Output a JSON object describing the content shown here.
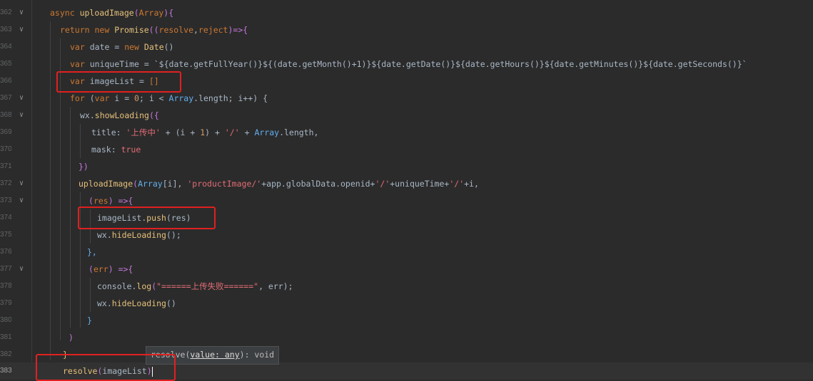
{
  "editor": {
    "lines": [
      {
        "num": "362",
        "fold": true
      },
      {
        "num": "363",
        "fold": true
      },
      {
        "num": "364",
        "fold": false
      },
      {
        "num": "365",
        "fold": false
      },
      {
        "num": "366",
        "fold": false
      },
      {
        "num": "367",
        "fold": true
      },
      {
        "num": "368",
        "fold": true
      },
      {
        "num": "369",
        "fold": false
      },
      {
        "num": "370",
        "fold": false
      },
      {
        "num": "371",
        "fold": false
      },
      {
        "num": "372",
        "fold": true
      },
      {
        "num": "373",
        "fold": true
      },
      {
        "num": "374",
        "fold": false
      },
      {
        "num": "375",
        "fold": false
      },
      {
        "num": "376",
        "fold": false
      },
      {
        "num": "377",
        "fold": true
      },
      {
        "num": "378",
        "fold": false
      },
      {
        "num": "379",
        "fold": false
      },
      {
        "num": "380",
        "fold": false
      },
      {
        "num": "381",
        "fold": false
      },
      {
        "num": "382",
        "fold": false
      },
      {
        "num": "383",
        "fold": false
      }
    ],
    "current_line": "383",
    "code": {
      "l362": {
        "kw": "async",
        "fn": "uploadImage",
        "open": "(",
        "param": "Array",
        "close": "){"
      },
      "l363": {
        "kw": "return",
        "kw2": "new",
        "cls": "Promise",
        "p1": "((",
        "a": "resolve",
        "comma": ",",
        "b": "reject",
        "p2": ")=>{"
      },
      "l364": {
        "kw": "var",
        "name": "date",
        "eq": " = ",
        "kw2": "new",
        "cls": "Date",
        "p": "()"
      },
      "l365": {
        "kw": "var",
        "name": "uniqueTime",
        "eq": " = ",
        "tpl": "`${date.getFullYear()}${(date.getMonth()+1)}${date.getDate()}${date.getHours()}${date.getMinutes()}${date.getSeconds()}`"
      },
      "l366": {
        "kw": "var",
        "name": "imageList",
        "eq": " = ",
        "val": "[]"
      },
      "l367": {
        "kw": "for",
        "open": " (",
        "kw2": "var",
        "rest1": " i = ",
        "zero": "0",
        "rest2": "; i < ",
        "arr": "Array",
        "rest3": ".length; i++) {"
      },
      "l368": {
        "obj": "wx",
        "dot": ".",
        "fn": "showLoading",
        "p": "({"
      },
      "l369": {
        "key": "title",
        "colon": ": ",
        "str": "'上传中'",
        "rest": " + (i + ",
        "one": "1",
        "rest2": ") + ",
        "str2": "'/'",
        "rest3": " + ",
        "arr": "Array",
        "rest4": ".length,"
      },
      "l370": {
        "key": "mask",
        "colon": ": ",
        "val": "true"
      },
      "l371": {
        "text": "})"
      },
      "l372": {
        "fn": "uploadImage",
        "open": "(",
        "arr": "Array",
        "rest1": "[i], ",
        "str": "'productImage/'",
        "rest2": "+app.globalData.openid+",
        "str2": "'/'",
        "rest3": "+uniqueTime+",
        "str3": "'/'",
        "rest4": "+i,"
      },
      "l373": {
        "open": "(",
        "arg": "res",
        "close": ") =>{"
      },
      "l374": {
        "obj": "imageList",
        "dot": ".",
        "fn": "push",
        "args": "(res)"
      },
      "l375": {
        "obj": "wx",
        "dot": ".",
        "fn": "hideLoading",
        "args": "();"
      },
      "l376": {
        "text": "},"
      },
      "l377": {
        "open": "(",
        "arg": "err",
        "close": ") =>{"
      },
      "l378": {
        "obj": "console",
        "dot": ".",
        "fn": "log",
        "open": "(",
        "str": "\"======上传失败======\"",
        "rest": ", err);"
      },
      "l379": {
        "obj": "wx",
        "dot": ".",
        "fn": "hideLoading",
        "args": "()"
      },
      "l380": {
        "text": "}"
      },
      "l381": {
        "text": ")"
      },
      "l382": {
        "text": "}"
      },
      "l383": {
        "fn": "resolve",
        "open": "(",
        "arg": "imageList",
        "close": ")"
      }
    },
    "tooltip": {
      "prefix": "resolve(",
      "param": "value: any",
      "suffix": "): void"
    }
  }
}
